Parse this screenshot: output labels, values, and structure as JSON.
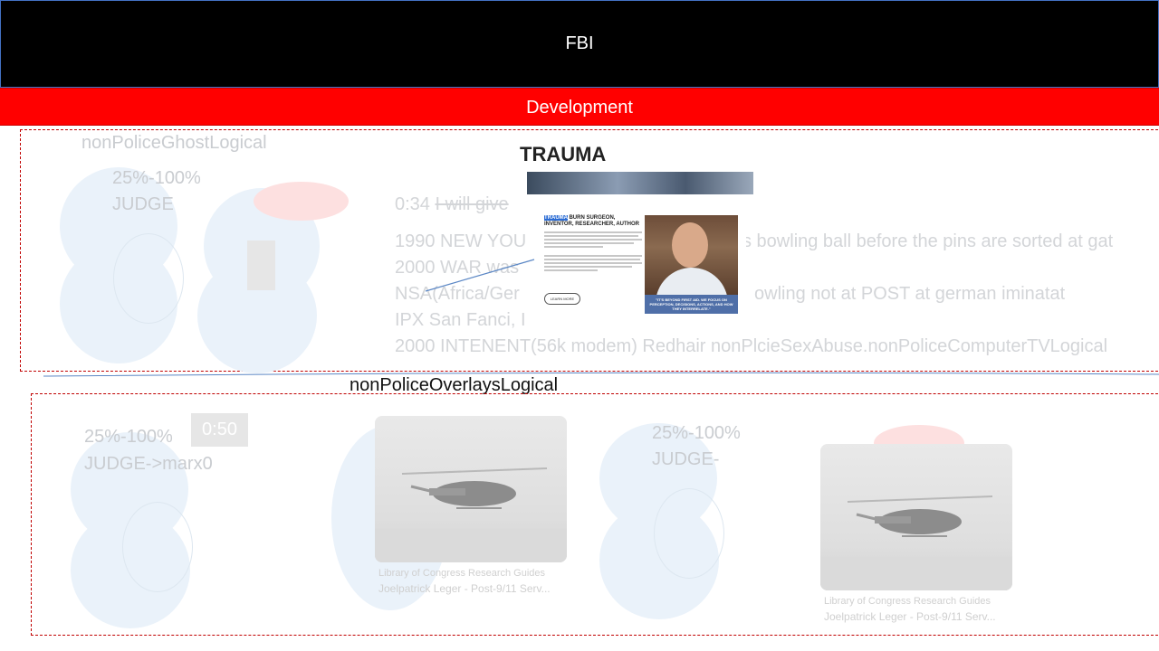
{
  "header": {
    "title": "FBI"
  },
  "banner": {
    "label": "Development"
  },
  "section1": {
    "label": "nonPoliceGhostLogical",
    "score": "25%-100%",
    "role": "JUDGE",
    "time_prefix": "0:34",
    "time_text": "I will give",
    "lines": [
      "1990 NEW YOU",
      "2000 WAR was",
      "NSA(Africa/Ger",
      "IPX San Fanci, I",
      "2000 INTENENT(56k modem) Redhair nonPlcieSexAbuse.nonPoliceComputerTVLogical"
    ],
    "line1_tail": "s bowling ball before the pins are sorted at gat",
    "line3_tail": "owling not at POST at german iminatat"
  },
  "trauma": {
    "title": "TRAUMA",
    "headline_highlight": "TRAUMA",
    "headline_rest": " BURN SURGEON, INVENTOR, RESEARCHER, AUTHOR",
    "learn_more": "LEARN MORE",
    "quote": "\"IT'S BEYOND FIRST AID. WE FOCUS ON PERCEPTION, DECISIONS, ACTIONS, AND HOW THEY INTERRELATE.\""
  },
  "section2": {
    "label": "nonPoliceOverlaysLogical",
    "score_a": "25%-100%",
    "role_a": "JUDGE->marx0",
    "timer": "0:50",
    "score_b": "25%-100%",
    "role_b": "JUDGE-",
    "cards": [
      {
        "source": "Library of Congress Research Guides",
        "title": "Joelpatrick Leger - Post-9/11 Serv..."
      },
      {
        "source": "Library of Congress Research Guides",
        "title": "Joelpatrick Leger - Post-9/11 Serv..."
      }
    ]
  }
}
